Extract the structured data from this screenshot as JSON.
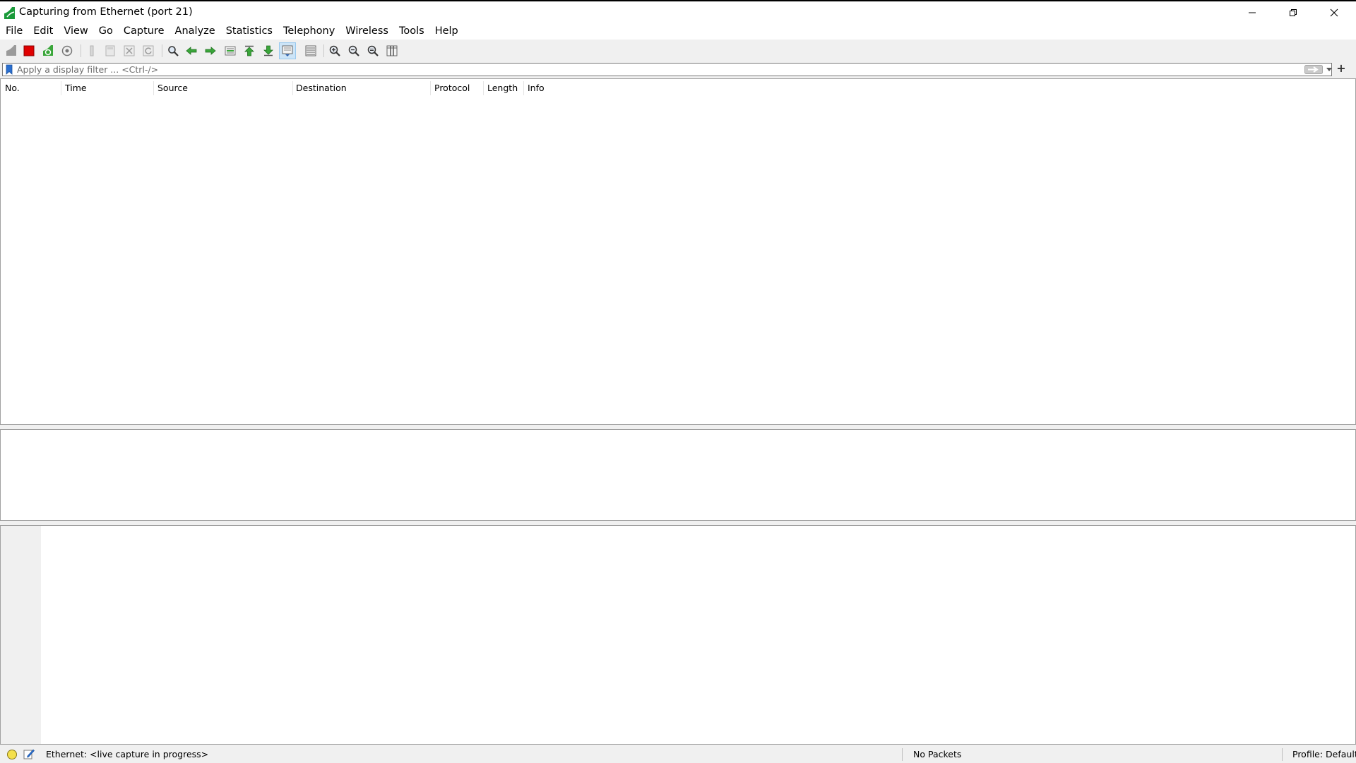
{
  "window": {
    "title": "Capturing from Ethernet (port 21)",
    "app_icon": "wireshark-fin-icon",
    "controls": [
      "minimize-icon",
      "restore-icon",
      "close-icon"
    ]
  },
  "menu": {
    "items": [
      "File",
      "Edit",
      "View",
      "Go",
      "Capture",
      "Analyze",
      "Statistics",
      "Telephony",
      "Wireless",
      "Tools",
      "Help"
    ]
  },
  "toolbar": {
    "buttons": [
      "start-capture-icon",
      "stop-capture-icon",
      "restart-capture-icon",
      "capture-options-icon",
      "open-file-icon",
      "save-file-icon",
      "close-file-icon",
      "reload-file-icon",
      "find-packet-icon",
      "go-back-icon",
      "go-forward-icon",
      "go-to-packet-icon",
      "first-packet-icon",
      "last-packet-icon",
      "auto-scroll-icon",
      "colorize-icon",
      "zoom-in-icon",
      "zoom-out-icon",
      "normal-size-icon",
      "resize-columns-icon"
    ],
    "accent_colors": {
      "stop": "#e00000",
      "arrows": "#3aa63a",
      "active_bg": "#cce4f7"
    }
  },
  "filter": {
    "placeholder": "Apply a display filter ... <Ctrl-/>",
    "value": "",
    "add_label": "+"
  },
  "packet_list": {
    "columns": [
      "No.",
      "Time",
      "Source",
      "Destination",
      "Protocol",
      "Length",
      "Info"
    ],
    "rows": []
  },
  "status": {
    "capture": "Ethernet: <live capture in progress>",
    "packets": "No Packets",
    "profile": "Profile: Default",
    "led_color": "#f4e04d"
  }
}
